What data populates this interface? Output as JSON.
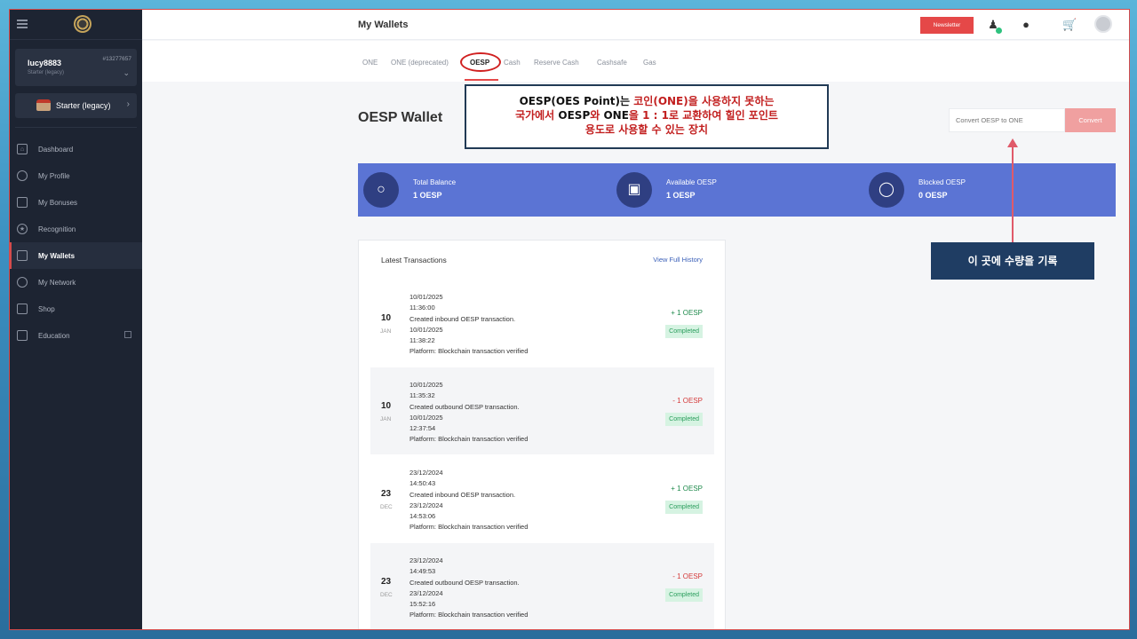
{
  "sidebar": {
    "user": {
      "name": "lucy8883",
      "id": "#13277657",
      "role": "Starter (legacy)"
    },
    "plan": {
      "label": "Starter (legacy)"
    },
    "items": [
      {
        "label": "Dashboard",
        "icon": "home-icon"
      },
      {
        "label": "My Profile",
        "icon": "user-icon"
      },
      {
        "label": "My Bonuses",
        "icon": "gift-icon"
      },
      {
        "label": "Recognition",
        "icon": "star-icon"
      },
      {
        "label": "My Wallets",
        "icon": "wallet-icon",
        "active": true
      },
      {
        "label": "My Network",
        "icon": "network-icon"
      },
      {
        "label": "Shop",
        "icon": "cart-icon"
      },
      {
        "label": "Education",
        "icon": "graduation-icon"
      }
    ]
  },
  "header": {
    "title": "My Wallets",
    "newsletter": "Newsletter"
  },
  "tabs": [
    "ONE",
    "ONE (deprecated)",
    "OESP",
    "Cash",
    "Reserve Cash",
    "Cashsafe",
    "Gas"
  ],
  "wallet": {
    "title": "OESP Wallet",
    "convert_placeholder": "Convert OESP to ONE",
    "convert_button": "Convert"
  },
  "balances": [
    {
      "label": "Total Balance",
      "value": "1 OESP"
    },
    {
      "label": "Available OESP",
      "value": "1 OESP"
    },
    {
      "label": "Blocked OESP",
      "value": "0 OESP"
    }
  ],
  "transactions": {
    "heading": "Latest Transactions",
    "view_link": "View Full History",
    "rows": [
      {
        "day": "10",
        "month": "JAN",
        "lines": [
          "10/01/2025",
          "11:36:00",
          "Created inbound OESP transaction.",
          "10/01/2025",
          "11:38:22",
          "Platform: Blockchain transaction verified"
        ],
        "amount": "+ 1 OESP",
        "status": "Completed"
      },
      {
        "day": "10",
        "month": "JAN",
        "lines": [
          "10/01/2025",
          "11:35:32",
          "Created outbound OESP transaction.",
          "10/01/2025",
          "12:37:54",
          "Platform: Blockchain transaction verified"
        ],
        "amount": "- 1 OESP",
        "status": "Completed"
      },
      {
        "day": "23",
        "month": "DEC",
        "lines": [
          "23/12/2024",
          "14:50:43",
          "Created inbound OESP transaction.",
          "23/12/2024",
          "14:53:06",
          "Platform: Blockchain transaction verified"
        ],
        "amount": "+ 1 OESP",
        "status": "Completed"
      },
      {
        "day": "23",
        "month": "DEC",
        "lines": [
          "23/12/2024",
          "14:49:53",
          "Created outbound OESP transaction.",
          "23/12/2024",
          "15:52:16",
          "Platform: Blockchain transaction verified"
        ],
        "amount": "- 1 OESP",
        "status": "Completed"
      }
    ]
  },
  "annotations": {
    "note_line1_a": "OESP(OES Point)는 ",
    "note_line1_b": "코인(ONE)을 사용하지 못하는",
    "note_line2_a": "국가에서 ",
    "note_line2_b": "OESP",
    "note_line2_c": "와 ",
    "note_line2_d": "ONE",
    "note_line2_e": "을 1 : 1로 교환하여 힐인 포인트",
    "note_line3": "용도로 사용할 수 있는 장치",
    "callout": "이 곳에 수량을 기록"
  },
  "colors": {
    "accent": "#e54848",
    "sidebar": "#1d2432",
    "balance_bar": "#5b74d4",
    "callout": "#1f3d63"
  }
}
